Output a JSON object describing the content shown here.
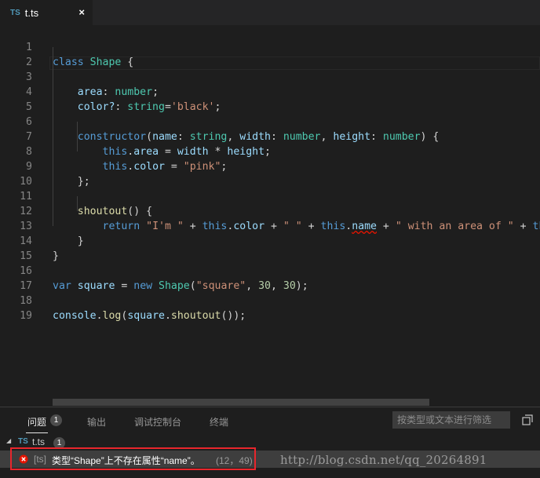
{
  "tab": {
    "lang_badge": "TS",
    "title": "t.ts",
    "close": "×"
  },
  "editor": {
    "line_numbers": [
      "1",
      "2",
      "3",
      "4",
      "5",
      "6",
      "7",
      "8",
      "9",
      "10",
      "11",
      "12",
      "13",
      "14",
      "15",
      "16",
      "17",
      "18",
      "19"
    ],
    "code": {
      "class_kw": "class",
      "class_name": "Shape",
      "area": "area",
      "number_t": "number",
      "color_opt": "color?",
      "string_t": "string",
      "black_str": "'black'",
      "constructor": "constructor",
      "name": "name",
      "width": "width",
      "height": "height",
      "this_kw": "this",
      "color": "color",
      "pink_str": "\"pink\"",
      "shoutout": "shoutout",
      "return_kw": "return",
      "im_str": "\"I'm \"",
      "space_str": "\" \"",
      "with_str": "\" with an area of \"",
      "var_kw": "var",
      "square": "square",
      "new_kw": "new",
      "square_str": "\"square\"",
      "n30": "30",
      "console": "console",
      "log": "log"
    }
  },
  "panel": {
    "tabs": [
      {
        "label": "问题",
        "count": "1"
      },
      {
        "label": "输出"
      },
      {
        "label": "调试控制台"
      },
      {
        "label": "终端"
      }
    ],
    "filter_placeholder": "按类型或文本进行筛选",
    "file": {
      "lang_badge": "TS",
      "name": "t.ts",
      "count": "1"
    },
    "error": {
      "source": "[ts]",
      "message": "类型“Shape”上不存在属性“name”。",
      "location": "(12，49)"
    }
  },
  "watermark": "http://blog.csdn.net/qq_20264891",
  "colors": {
    "error": "#e51400",
    "highlight_box": "#e8262c",
    "accent": "#519aba"
  }
}
